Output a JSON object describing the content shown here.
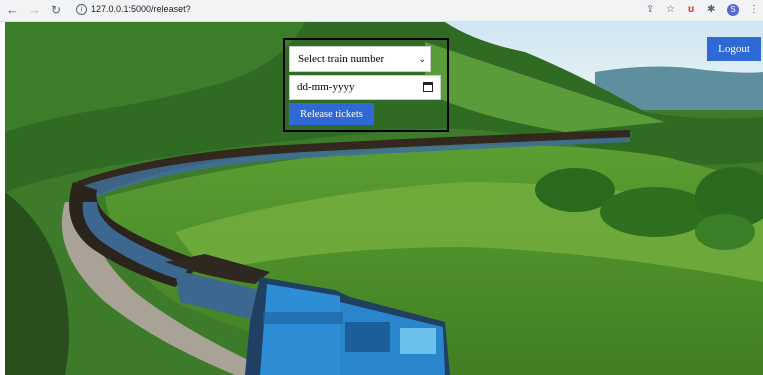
{
  "browser": {
    "url": "127.0.0.1:5000/releaset?",
    "profile_initial": "S",
    "icons": [
      "back-icon",
      "forward-icon",
      "reload-icon",
      "info-icon",
      "share-icon",
      "star-icon",
      "extension-icon",
      "puzzle-icon",
      "profile-avatar",
      "menu-icon"
    ]
  },
  "page": {
    "logout_label": "Logout",
    "train_select": {
      "selected": "Select train number"
    },
    "date_input": {
      "placeholder": "dd-mm-yyyy"
    },
    "release_label": "Release tickets"
  },
  "colors": {
    "button_blue": "#2f69d6"
  }
}
